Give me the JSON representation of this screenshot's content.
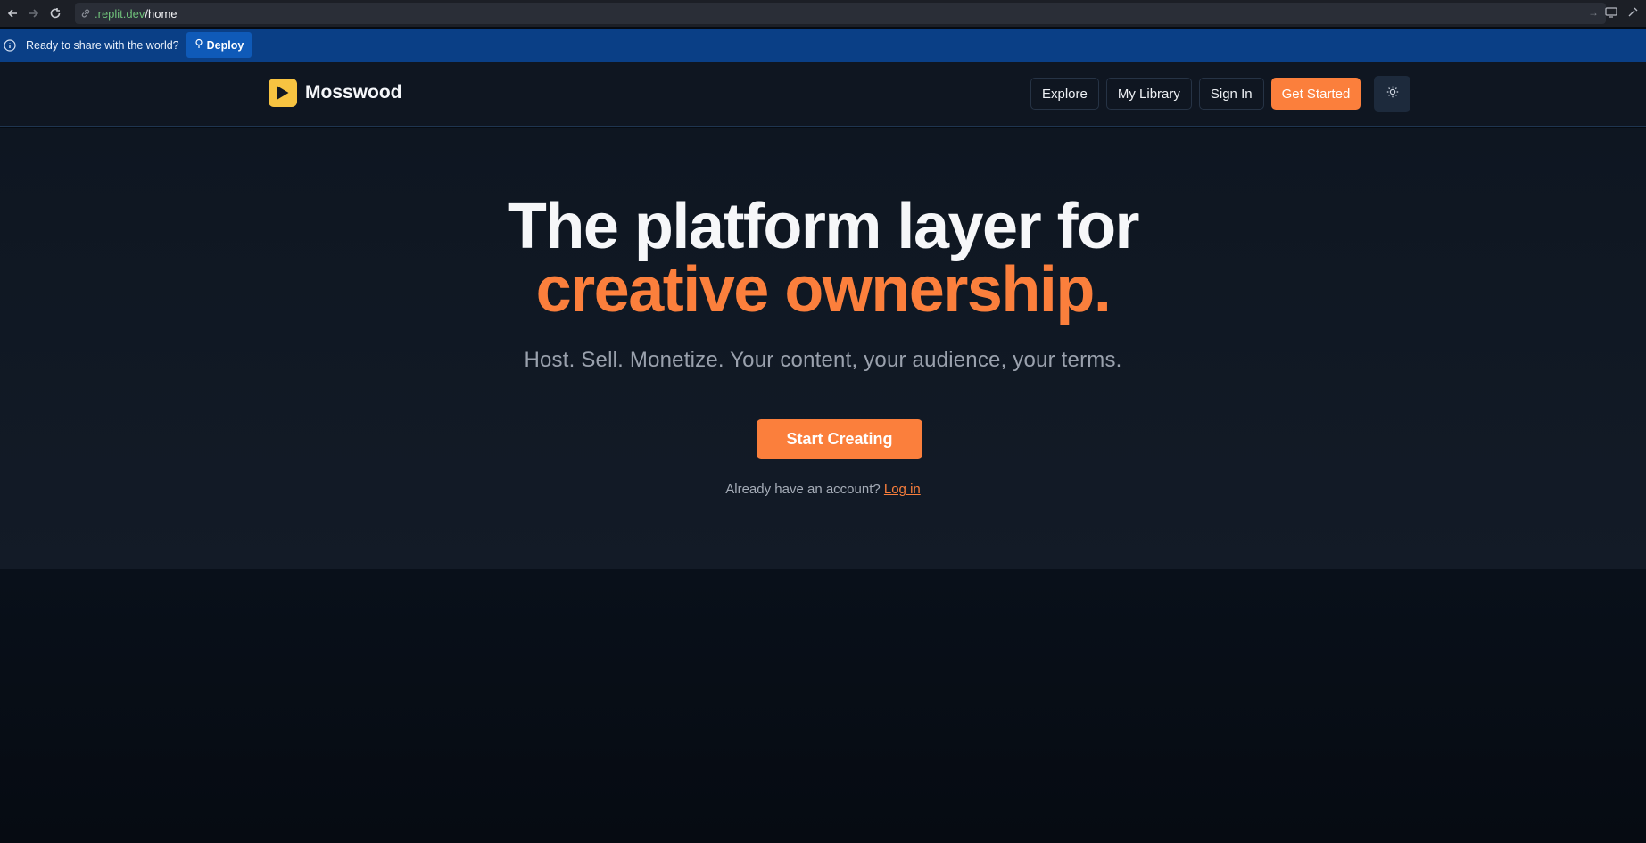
{
  "browser": {
    "url_host": ".replit.dev",
    "url_path": "/home"
  },
  "banner": {
    "message": "Ready to share with the world?",
    "deploy_label": "Deploy"
  },
  "header": {
    "brand": "Mosswood",
    "nav": {
      "explore": "Explore",
      "library": "My Library",
      "signin": "Sign In",
      "get_started": "Get Started"
    }
  },
  "hero": {
    "title_line1": "The platform layer for",
    "title_line2": "creative ownership.",
    "subtitle": "Host. Sell. Monetize. Your content, your audience, your terms.",
    "cta": "Start Creating",
    "login_prompt": "Already have an account?",
    "login_link": "Log in"
  },
  "colors": {
    "accent": "#fb7f3c",
    "logo": "#f7c341",
    "banner": "#0a3f86",
    "background": "#0e1621"
  }
}
